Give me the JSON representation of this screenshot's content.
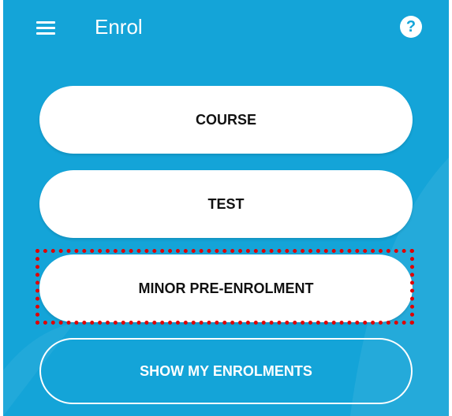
{
  "header": {
    "title": "Enrol",
    "menu_icon": "hamburger-menu-icon",
    "help_icon": "help-icon",
    "help_glyph": "?"
  },
  "options": {
    "course_label": "COURSE",
    "test_label": "TEST",
    "minor_label": "MINOR PRE-ENROLMENT",
    "show_enrolments_label": "SHOW MY ENROLMENTS"
  },
  "colors": {
    "background": "#14a4d8",
    "button": "#ffffff",
    "highlight": "#e00000"
  }
}
